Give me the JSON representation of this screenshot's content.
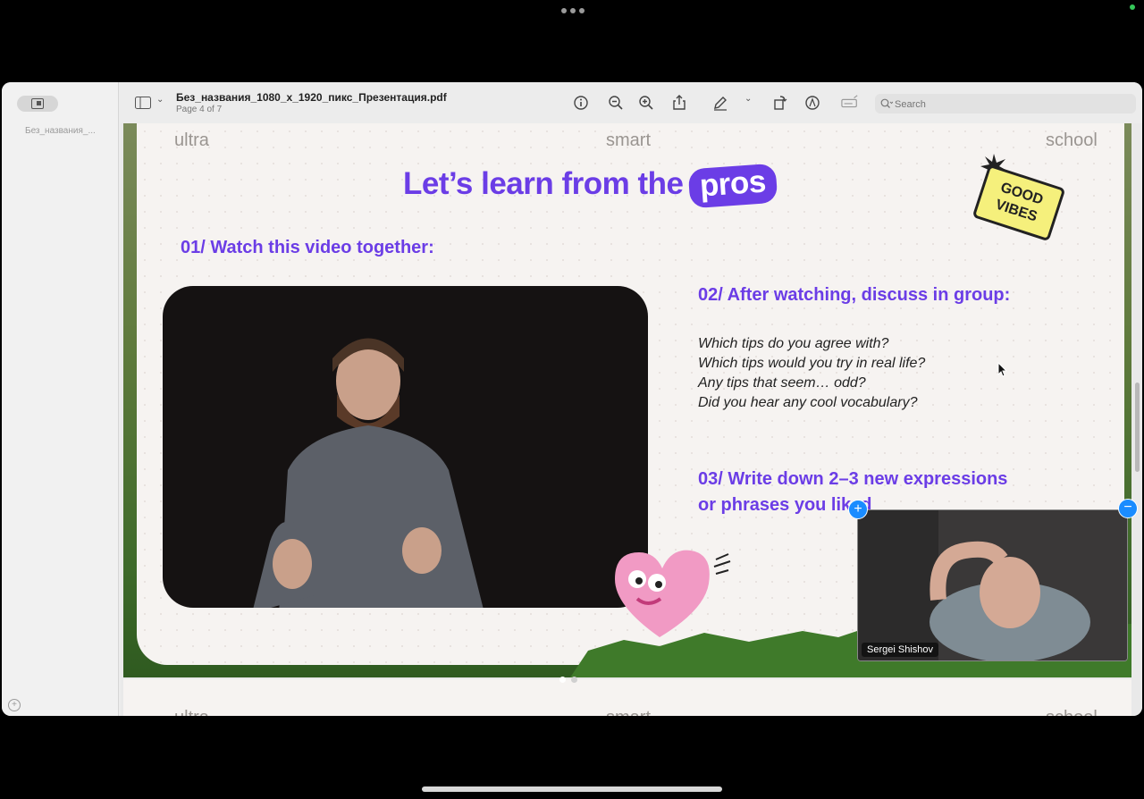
{
  "window": {
    "title": "Без_названия_1080_x_1920_пикс_Презентация.pdf",
    "page_indicator": "Page 4 of 7"
  },
  "sidebar": {
    "thumbnail_label": "Без_названия_..."
  },
  "toolbar": {
    "search_placeholder": "Search",
    "icons": [
      "sidebar-icon",
      "chevron-down-icon",
      "info-icon",
      "zoom-out-icon",
      "zoom-in-icon",
      "share-icon",
      "markup-pen-icon",
      "chevron-down-icon",
      "rotate-icon",
      "markup-circle-icon",
      "form-fill-icon",
      "search-icon"
    ]
  },
  "slide": {
    "brand_left": "ultra",
    "brand_center": "smart",
    "brand_right": "school",
    "headline": "Let’s learn from the",
    "headline_highlight": "pros",
    "sticker_line1": "GOOD",
    "sticker_line2": "VIBES",
    "section1": "01/ Watch this video together:",
    "section2": "02/ After watching, discuss in group:",
    "questions": [
      "Which tips do you agree with?",
      "Which tips would you try in real life?",
      "Any tips that seem… odd?",
      "Did you hear any cool vocabulary?"
    ],
    "section3_line1": "03/ Write down 2–3 new expressions",
    "section3_line2": "or phrases you liked"
  },
  "next_slide": {
    "brand_left": "ultra",
    "brand_center": "smart",
    "brand_right": "school"
  },
  "video_call": {
    "participant_name": "Sergei Shishov",
    "add_label": "+",
    "remove_label": "−"
  },
  "colors": {
    "accent_purple": "#6b3de6",
    "sticker_yellow": "#f5f07c",
    "pip_button_blue": "#1a8cff"
  }
}
